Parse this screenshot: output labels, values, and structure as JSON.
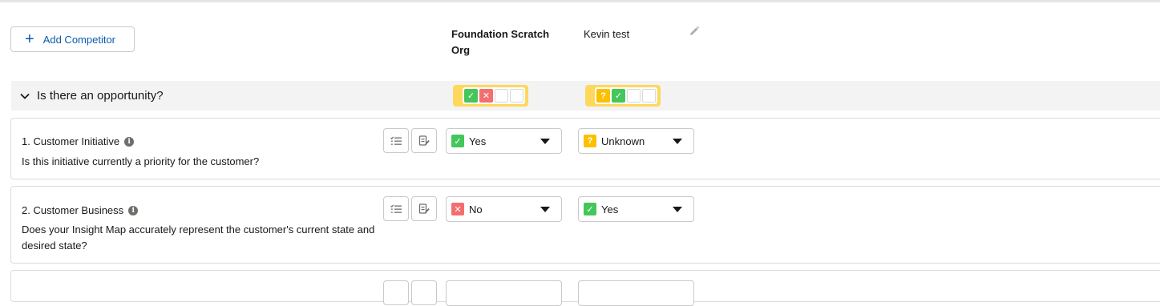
{
  "toolbar": {
    "add_competitor_label": "Add Competitor",
    "plus_icon": "+"
  },
  "columns": [
    {
      "name": "Foundation Scratch Org"
    },
    {
      "name": "Kevin test"
    }
  ],
  "section": {
    "title": "Is there an opportunity?",
    "summaries": [
      {
        "icons": [
          "check",
          "x",
          "empty",
          "empty"
        ]
      },
      {
        "icons": [
          "question",
          "check",
          "empty",
          "empty"
        ]
      }
    ]
  },
  "questions": [
    {
      "number_title": "1. Customer Initiative",
      "info_icon": "i",
      "text": "Is this initiative currently a priority for the customer?",
      "answers": [
        {
          "value": "Yes",
          "status": "yes",
          "glyph": "✓"
        },
        {
          "value": "Unknown",
          "status": "unknown",
          "glyph": "?"
        }
      ]
    },
    {
      "number_title": "2. Customer Business",
      "info_icon": "i",
      "text": "Does your Insight Map accurately represent the customer's current state and desired state?",
      "answers": [
        {
          "value": "No",
          "status": "no",
          "glyph": "✕"
        },
        {
          "value": "Yes",
          "status": "yes",
          "glyph": "✓"
        }
      ]
    }
  ],
  "colors": {
    "accent_blue": "#0b5cab",
    "yes_green": "#2e844a",
    "no_red": "#ea001e",
    "unknown_yellow": "#fcc003",
    "summary_yellow": "#fdd85d",
    "section_bg": "#f3f3f3"
  }
}
